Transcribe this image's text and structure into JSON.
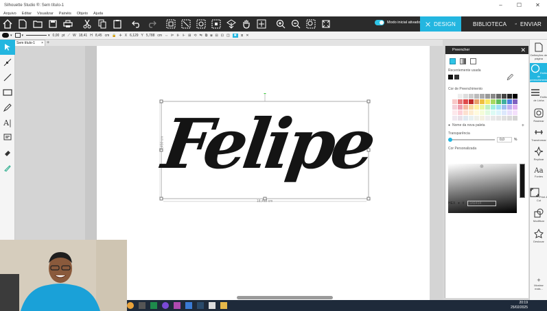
{
  "window": {
    "title": "Silhouette Studio ®: Sem título-1",
    "controls": [
      "–",
      "☐",
      "✕"
    ]
  },
  "menu": [
    "Arquivo",
    "Editar",
    "Visualizar",
    "Painéis",
    "Objeto",
    "Ajuda"
  ],
  "topbar": {
    "mode_label": "Modo inicial ativado",
    "design": "DESIGN",
    "biblioteca": "BIBLIOTECA",
    "enviar": "ENVIAR"
  },
  "options": {
    "line_width": "0,00",
    "line_unit": "pt",
    "w_value": "18,41",
    "h_value": "8,45",
    "wh_unit": "cm",
    "x_value": "6,129",
    "y_value": "5,788",
    "xy_unit": "cm"
  },
  "document_tab": "Sem título-1",
  "canvas": {
    "text": "Felipe",
    "height_dimension": "8,450 cm",
    "width_dimension": "18,412 cm"
  },
  "panel": {
    "title": "Preencher",
    "recent_label": "Recentemente usada",
    "fill_color_label": "Cor de Preenchimento",
    "palette_name": "Nome da nova paleta",
    "transparency_label": "Transparência",
    "transparency_value": "0,0",
    "transparency_unit": "%",
    "custom_label": "Cor Personalizada",
    "hex_label": "HEX",
    "hex_value": "141414"
  },
  "right_nav": [
    "Definições de página",
    "Estilo de preenchimento",
    "Estilo de Linha",
    "Rastrear",
    "Transformar",
    "Replicar",
    "Fontes",
    "Print & Cut",
    "Modificar",
    "Deslocar",
    "Mostrar mais..."
  ],
  "taskbar": {
    "time": "20:19",
    "date": "25/02/2025"
  },
  "colors": {
    "accent": "#23b6e0",
    "toolbar": "#2b2b2b",
    "text_fill": "#141414"
  }
}
